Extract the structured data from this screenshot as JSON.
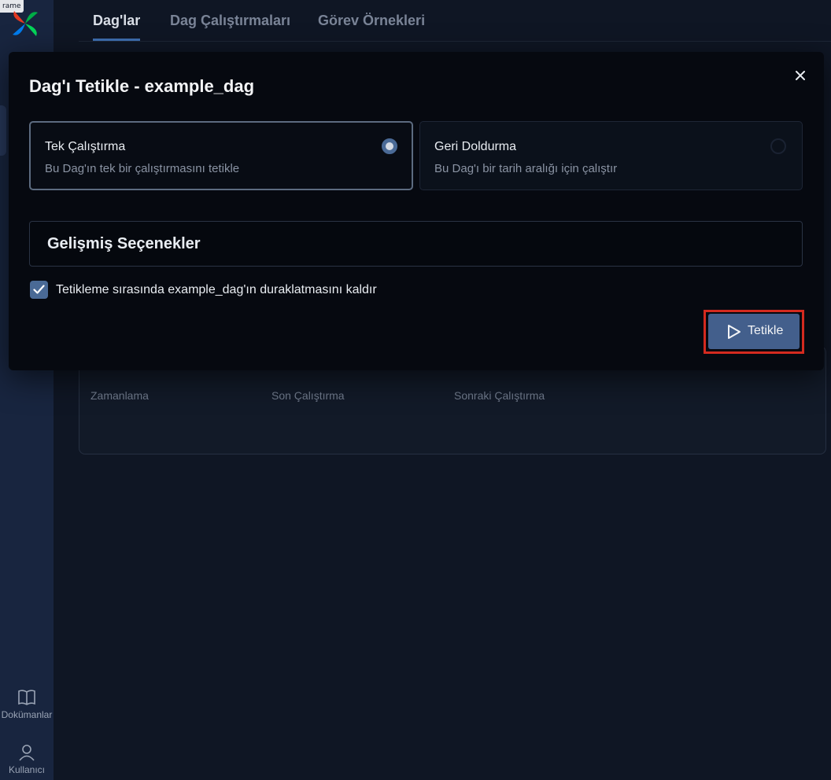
{
  "frame_tag": "rame",
  "tabs": [
    {
      "label": "Dag'lar"
    },
    {
      "label": "Dag Çalıştırmaları"
    },
    {
      "label": "Görev Örnekleri"
    }
  ],
  "sidebar": {
    "docs_label": "Dokümanlar",
    "user_label": "Kullanıcı"
  },
  "background_table": {
    "columns": [
      "Zamanlama",
      "Son Çalıştırma",
      "Sonraki Çalıştırma"
    ]
  },
  "modal": {
    "title": "Dag'ı Tetikle - example_dag",
    "options": [
      {
        "title": "Tek Çalıştırma",
        "description": "Bu Dag'ın tek bir çalıştırmasını tetikle",
        "selected": true
      },
      {
        "title": "Geri Doldurma",
        "description": "Bu Dag'ı bir tarih aralığı için çalıştır",
        "selected": false
      }
    ],
    "advanced_label": "Gelişmiş Seçenekler",
    "unpause_checkbox": {
      "label": "Tetikleme sırasında example_dag'ın duraklatmasını kaldır",
      "checked": true
    },
    "trigger_button_label": "Tetikle"
  },
  "colors": {
    "accent": "#4a6a96",
    "highlight_outline": "#d42a1f"
  }
}
